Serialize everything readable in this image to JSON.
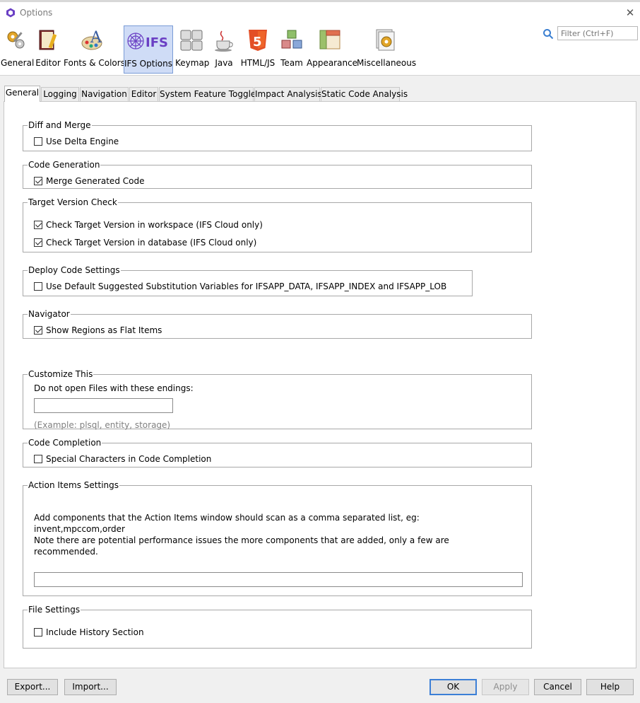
{
  "window": {
    "title": "Options"
  },
  "toolbar": {
    "items": [
      {
        "label": "General"
      },
      {
        "label": "Editor"
      },
      {
        "label": "Fonts & Colors"
      },
      {
        "label": "IFS Options"
      },
      {
        "label": "Keymap"
      },
      {
        "label": "Java"
      },
      {
        "label": "HTML/JS"
      },
      {
        "label": "Team"
      },
      {
        "label": "Appearance"
      },
      {
        "label": "Miscellaneous"
      }
    ],
    "active_index": 3,
    "ifs_logo_text": "IFS",
    "html5_badge": "5",
    "filter_placeholder": "Filter (Ctrl+F)"
  },
  "tabs": [
    {
      "label": "General"
    },
    {
      "label": "Logging"
    },
    {
      "label": "Navigation"
    },
    {
      "label": "Editor"
    },
    {
      "label": "System Feature Toggles"
    },
    {
      "label": "Impact Analysis"
    },
    {
      "label": "Static Code Analysis"
    }
  ],
  "groups": {
    "diff_merge": {
      "title": "Diff and Merge",
      "use_delta_engine": {
        "label": "Use Delta Engine",
        "checked": false
      }
    },
    "code_generation": {
      "title": "Code Generation",
      "merge_generated_code": {
        "label": "Merge Generated Code",
        "checked": true
      }
    },
    "target_version": {
      "title": "Target Version Check",
      "workspace": {
        "label": "Check Target Version in workspace (IFS Cloud only)",
        "checked": true
      },
      "database": {
        "label": "Check Target Version in database (IFS Cloud only)",
        "checked": true
      }
    },
    "deploy": {
      "title": "Deploy Code Settings",
      "substitution": {
        "label": "Use Default Suggested Substitution Variables for IFSAPP_DATA, IFSAPP_INDEX and IFSAPP_LOB",
        "checked": false
      }
    },
    "navigator": {
      "title": "Navigator",
      "flat_items": {
        "label": "Show Regions as Flat Items",
        "checked": true
      }
    },
    "customize": {
      "title": "Customize This",
      "endings_label": "Do not open Files with these endings:",
      "endings_value": "",
      "example": "(Example: plsql, entity, storage)"
    },
    "code_completion": {
      "title": "Code Completion",
      "special_chars": {
        "label": "Special Characters in Code Completion",
        "checked": false
      }
    },
    "action_items": {
      "title": "Action Items Settings",
      "line1": "Add components that the Action Items window should scan as a comma separated list, eg:",
      "line2": "invent,mpccom,order",
      "line3": "Note there are potential performance issues the more components that are added, only a few are",
      "line4": "recommended.",
      "components_value": ""
    },
    "file_settings": {
      "title": "File Settings",
      "history": {
        "label": "Include History Section",
        "checked": false
      }
    }
  },
  "buttons": {
    "export": "Export...",
    "import": "Import...",
    "ok": "OK",
    "apply": "Apply",
    "cancel": "Cancel",
    "help": "Help"
  }
}
